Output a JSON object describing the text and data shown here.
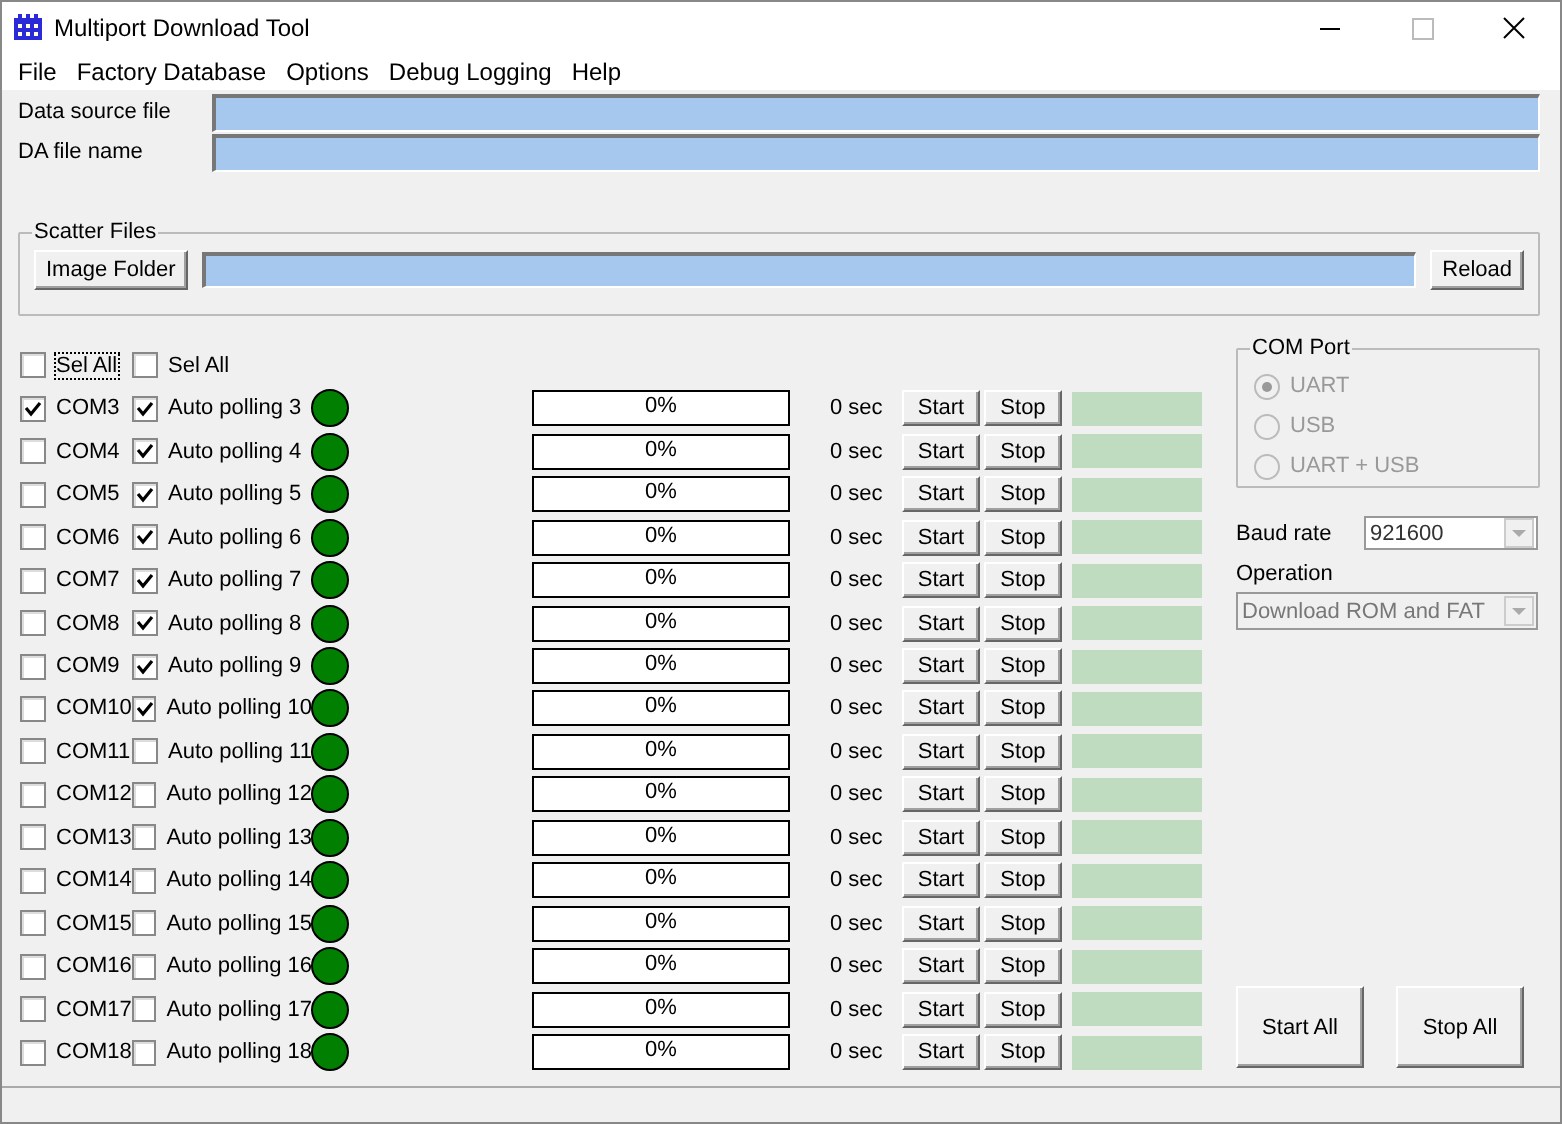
{
  "window": {
    "title": "Multiport Download Tool"
  },
  "menu": [
    "File",
    "Factory Database",
    "Options",
    "Debug Logging",
    "Help"
  ],
  "files": [
    {
      "label": "Data source file"
    },
    {
      "label": "DA file name"
    }
  ],
  "scatter": {
    "title": "Scatter Files",
    "folder_button": "Image Folder",
    "reload_button": "Reload"
  },
  "select_all": [
    {
      "label": "Sel All",
      "checked": false,
      "focused": true
    },
    {
      "label": "Sel All",
      "checked": false,
      "focused": false
    }
  ],
  "ports": [
    {
      "com": "COM3",
      "com_checked": true,
      "auto": "Auto polling 3",
      "auto_checked": true,
      "percent": "0%",
      "level": 0,
      "time": "0 sec",
      "start": "Start",
      "stop": "Stop"
    },
    {
      "com": "COM4",
      "com_checked": false,
      "auto": "Auto polling 4",
      "auto_checked": true,
      "percent": "0%",
      "level": 0,
      "time": "0 sec",
      "start": "Start",
      "stop": "Stop"
    },
    {
      "com": "COM5",
      "com_checked": false,
      "auto": "Auto polling 5",
      "auto_checked": true,
      "percent": "0%",
      "level": 0,
      "time": "0 sec",
      "start": "Start",
      "stop": "Stop"
    },
    {
      "com": "COM6",
      "com_checked": false,
      "auto": "Auto polling 6",
      "auto_checked": true,
      "percent": "0%",
      "level": 0,
      "time": "0 sec",
      "start": "Start",
      "stop": "Stop"
    },
    {
      "com": "COM7",
      "com_checked": false,
      "auto": "Auto polling 7",
      "auto_checked": true,
      "percent": "0%",
      "level": 0,
      "time": "0 sec",
      "start": "Start",
      "stop": "Stop"
    },
    {
      "com": "COM8",
      "com_checked": false,
      "auto": "Auto polling 8",
      "auto_checked": true,
      "percent": "0%",
      "level": 0,
      "time": "0 sec",
      "start": "Start",
      "stop": "Stop"
    },
    {
      "com": "COM9",
      "com_checked": false,
      "auto": "Auto polling 9",
      "auto_checked": true,
      "percent": "0%",
      "level": 0,
      "time": "0 sec",
      "start": "Start",
      "stop": "Stop"
    },
    {
      "com": "COM10",
      "com_checked": false,
      "auto": "Auto polling 10",
      "auto_checked": true,
      "percent": "0%",
      "level": 0,
      "time": "0 sec",
      "start": "Start",
      "stop": "Stop"
    },
    {
      "com": "COM11",
      "com_checked": false,
      "auto": "Auto polling 11",
      "auto_checked": false,
      "percent": "0%",
      "level": 0,
      "time": "0 sec",
      "start": "Start",
      "stop": "Stop"
    },
    {
      "com": "COM12",
      "com_checked": false,
      "auto": "Auto polling 12",
      "auto_checked": false,
      "percent": "0%",
      "level": 0,
      "time": "0 sec",
      "start": "Start",
      "stop": "Stop"
    },
    {
      "com": "COM13",
      "com_checked": false,
      "auto": "Auto polling 13",
      "auto_checked": false,
      "percent": "0%",
      "level": 0,
      "time": "0 sec",
      "start": "Start",
      "stop": "Stop"
    },
    {
      "com": "COM14",
      "com_checked": false,
      "auto": "Auto polling 14",
      "auto_checked": false,
      "percent": "0%",
      "level": 0,
      "time": "0 sec",
      "start": "Start",
      "stop": "Stop"
    },
    {
      "com": "COM15",
      "com_checked": false,
      "auto": "Auto polling 15",
      "auto_checked": false,
      "percent": "0%",
      "level": 0,
      "time": "0 sec",
      "start": "Start",
      "stop": "Stop"
    },
    {
      "com": "COM16",
      "com_checked": false,
      "auto": "Auto polling 16",
      "auto_checked": false,
      "percent": "0%",
      "level": 0,
      "time": "0 sec",
      "start": "Start",
      "stop": "Stop"
    },
    {
      "com": "COM17",
      "com_checked": false,
      "auto": "Auto polling 17",
      "auto_checked": false,
      "percent": "0%",
      "level": 0,
      "time": "0 sec",
      "start": "Start",
      "stop": "Stop"
    },
    {
      "com": "COM18",
      "com_checked": false,
      "auto": "Auto polling 18",
      "auto_checked": false,
      "percent": "0%",
      "level": 0,
      "time": "0 sec",
      "start": "Start",
      "stop": "Stop"
    }
  ],
  "com_port": {
    "title": "COM Port",
    "options": [
      {
        "label": "UART",
        "selected": true,
        "disabled": true
      },
      {
        "label": "USB",
        "selected": false,
        "disabled": true
      },
      {
        "label": "UART + USB",
        "selected": false,
        "disabled": true
      }
    ]
  },
  "baud_rate": {
    "label": "Baud rate",
    "value": "921600",
    "disabled": false
  },
  "operation": {
    "label": "Operation",
    "value": "Download ROM and FAT",
    "disabled": true
  },
  "buttons": [
    "Start All",
    "Stop All"
  ]
}
